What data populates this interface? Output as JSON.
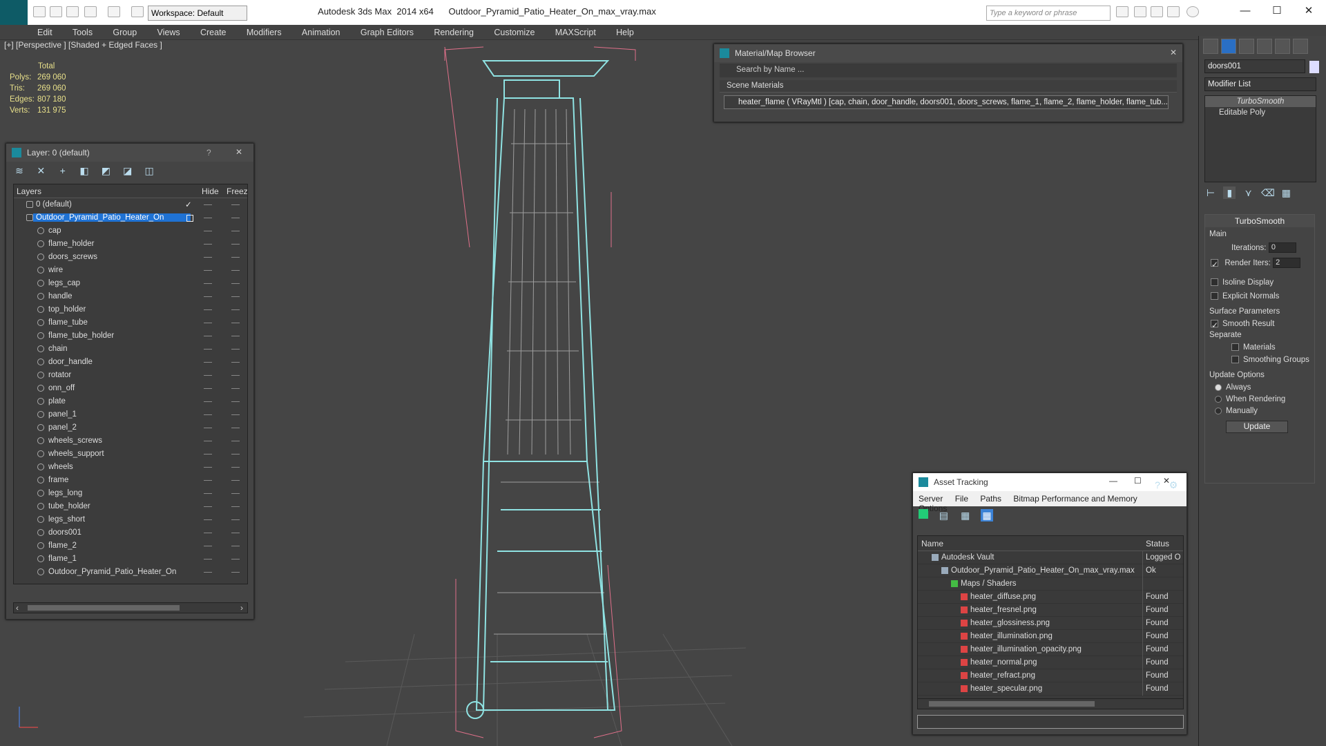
{
  "titlebar": {
    "title": "Autodesk 3ds Max  2014 x64      Outdoor_Pyramid_Patio_Heater_On_max_vray.max",
    "workspace": "Workspace: Default",
    "search_placeholder": "Type a keyword or phrase",
    "minimize": "—",
    "maximize": "☐",
    "close": "✕"
  },
  "menubar": [
    "Edit",
    "Tools",
    "Group",
    "Views",
    "Create",
    "Modifiers",
    "Animation",
    "Graph Editors",
    "Rendering",
    "Customize",
    "MAXScript",
    "Help"
  ],
  "viewport": {
    "label": "[+] [Perspective ] [Shaded + Edged Faces ]",
    "stats_header": "Total",
    "stats": [
      {
        "label": "Polys:",
        "value": "269 060"
      },
      {
        "label": "Tris:",
        "value": "269 060"
      },
      {
        "label": "Edges:",
        "value": "807 180"
      },
      {
        "label": "Verts:",
        "value": "131 975"
      }
    ]
  },
  "layers_panel": {
    "title": "Layer: 0 (default)",
    "help": "?",
    "close": "✕",
    "col_layers": "Layers",
    "col_hide": "Hide",
    "col_freeze": "Freeze",
    "default_layer": "0 (default)",
    "selected_layer": "Outdoor_Pyramid_Patio_Heater_On",
    "objects": [
      "cap",
      "flame_holder",
      "doors_screws",
      "wire",
      "legs_cap",
      "handle",
      "top_holder",
      "flame_tube",
      "flame_tube_holder",
      "chain",
      "door_handle",
      "rotator",
      "onn_off",
      "plate",
      "panel_1",
      "panel_2",
      "wheels_screws",
      "wheels_support",
      "wheels",
      "frame",
      "legs_long",
      "tube_holder",
      "legs_short",
      "doors001",
      "flame_2",
      "flame_1",
      "Outdoor_Pyramid_Patio_Heater_On"
    ]
  },
  "material_browser": {
    "title": "Material/Map Browser",
    "search_placeholder": "Search by Name ...",
    "section": "Scene Materials",
    "item": "heater_flame  ( VRayMtl )  [cap, chain, door_handle, doors001, doors_screws, flame_1, flame_2, flame_holder, flame_tub..."
  },
  "asset_tracking": {
    "title": "Asset Tracking",
    "menu": [
      "Server",
      "File",
      "Paths",
      "Bitmap Performance and Memory",
      "Options"
    ],
    "col_name": "Name",
    "col_status": "Status",
    "rows": [
      {
        "name": "Autodesk Vault",
        "status": "Logged O",
        "indent": 1
      },
      {
        "name": "Outdoor_Pyramid_Patio_Heater_On_max_vray.max",
        "status": "Ok",
        "indent": 2
      },
      {
        "name": "Maps / Shaders",
        "status": "",
        "indent": 3
      },
      {
        "name": "heater_diffuse.png",
        "status": "Found",
        "indent": 4
      },
      {
        "name": "heater_fresnel.png",
        "status": "Found",
        "indent": 4
      },
      {
        "name": "heater_glossiness.png",
        "status": "Found",
        "indent": 4
      },
      {
        "name": "heater_illumination.png",
        "status": "Found",
        "indent": 4
      },
      {
        "name": "heater_illumination_opacity.png",
        "status": "Found",
        "indent": 4
      },
      {
        "name": "heater_normal.png",
        "status": "Found",
        "indent": 4
      },
      {
        "name": "heater_refract.png",
        "status": "Found",
        "indent": 4
      },
      {
        "name": "heater_specular.png",
        "status": "Found",
        "indent": 4
      }
    ]
  },
  "command_panel": {
    "object_name": "doors001",
    "modifier_list": "Modifier List",
    "stack": [
      "TurboSmooth",
      "Editable Poly"
    ],
    "rollout_title": "TurboSmooth",
    "main_label": "Main",
    "iterations_label": "Iterations:",
    "iterations_value": "0",
    "render_iters_label": "Render Iters:",
    "render_iters_value": "2",
    "isoline": "Isoline Display",
    "explicit_normals": "Explicit Normals",
    "surface_params": "Surface Parameters",
    "smooth_result": "Smooth Result",
    "separate": "Separate",
    "materials": "Materials",
    "smoothing_groups": "Smoothing Groups",
    "update_options": "Update Options",
    "always": "Always",
    "when_rendering": "When Rendering",
    "manually": "Manually",
    "update_button": "Update"
  },
  "colors": {
    "accent": "#1f72d4",
    "wire": "#8fe3e3",
    "bbox": "#e0708a"
  }
}
